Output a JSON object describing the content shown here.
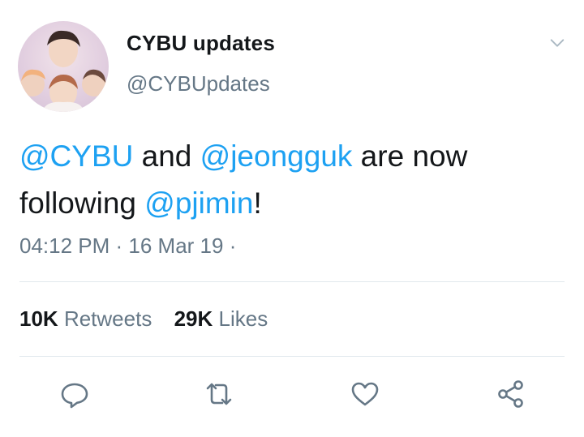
{
  "user": {
    "display_name": "CYBU updates",
    "handle": "@CYBUpdates"
  },
  "tweet": {
    "mention_1": "@CYBU",
    "text_1": " and ",
    "mention_2": "@jeongguk",
    "text_2": " are now following ",
    "mention_3": "@pjimin",
    "text_3": "!"
  },
  "meta": {
    "time": "04:12 PM",
    "separator": " · ",
    "date": "16 Mar 19",
    "trailing": " · "
  },
  "stats": {
    "retweets_count": "10K",
    "retweets_label": "Retweets",
    "likes_count": "29K",
    "likes_label": "Likes"
  },
  "colors": {
    "link": "#1da1f2",
    "secondary_text": "#657786",
    "divider": "#e1e8ed",
    "icon": "#657786"
  },
  "icons": [
    "chevron-down-icon",
    "reply-icon",
    "retweet-icon",
    "like-icon",
    "share-icon"
  ]
}
